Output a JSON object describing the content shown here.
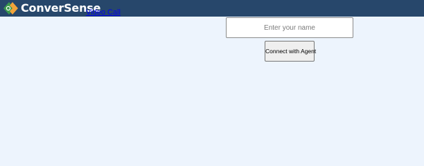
{
  "header": {
    "brand": "ConverSense",
    "logo_icon": "conversense-logo-icon",
    "nav_link": "Video Call"
  },
  "form": {
    "name_placeholder": "Enter your name",
    "name_value": "",
    "connect_label": "Connect with Agent"
  },
  "colors": {
    "header_bg": "#27476b",
    "page_bg": "#edf4fd",
    "logo_green": "#3b9a4c",
    "logo_orange": "#f2a33a",
    "link": "#0000ee"
  }
}
